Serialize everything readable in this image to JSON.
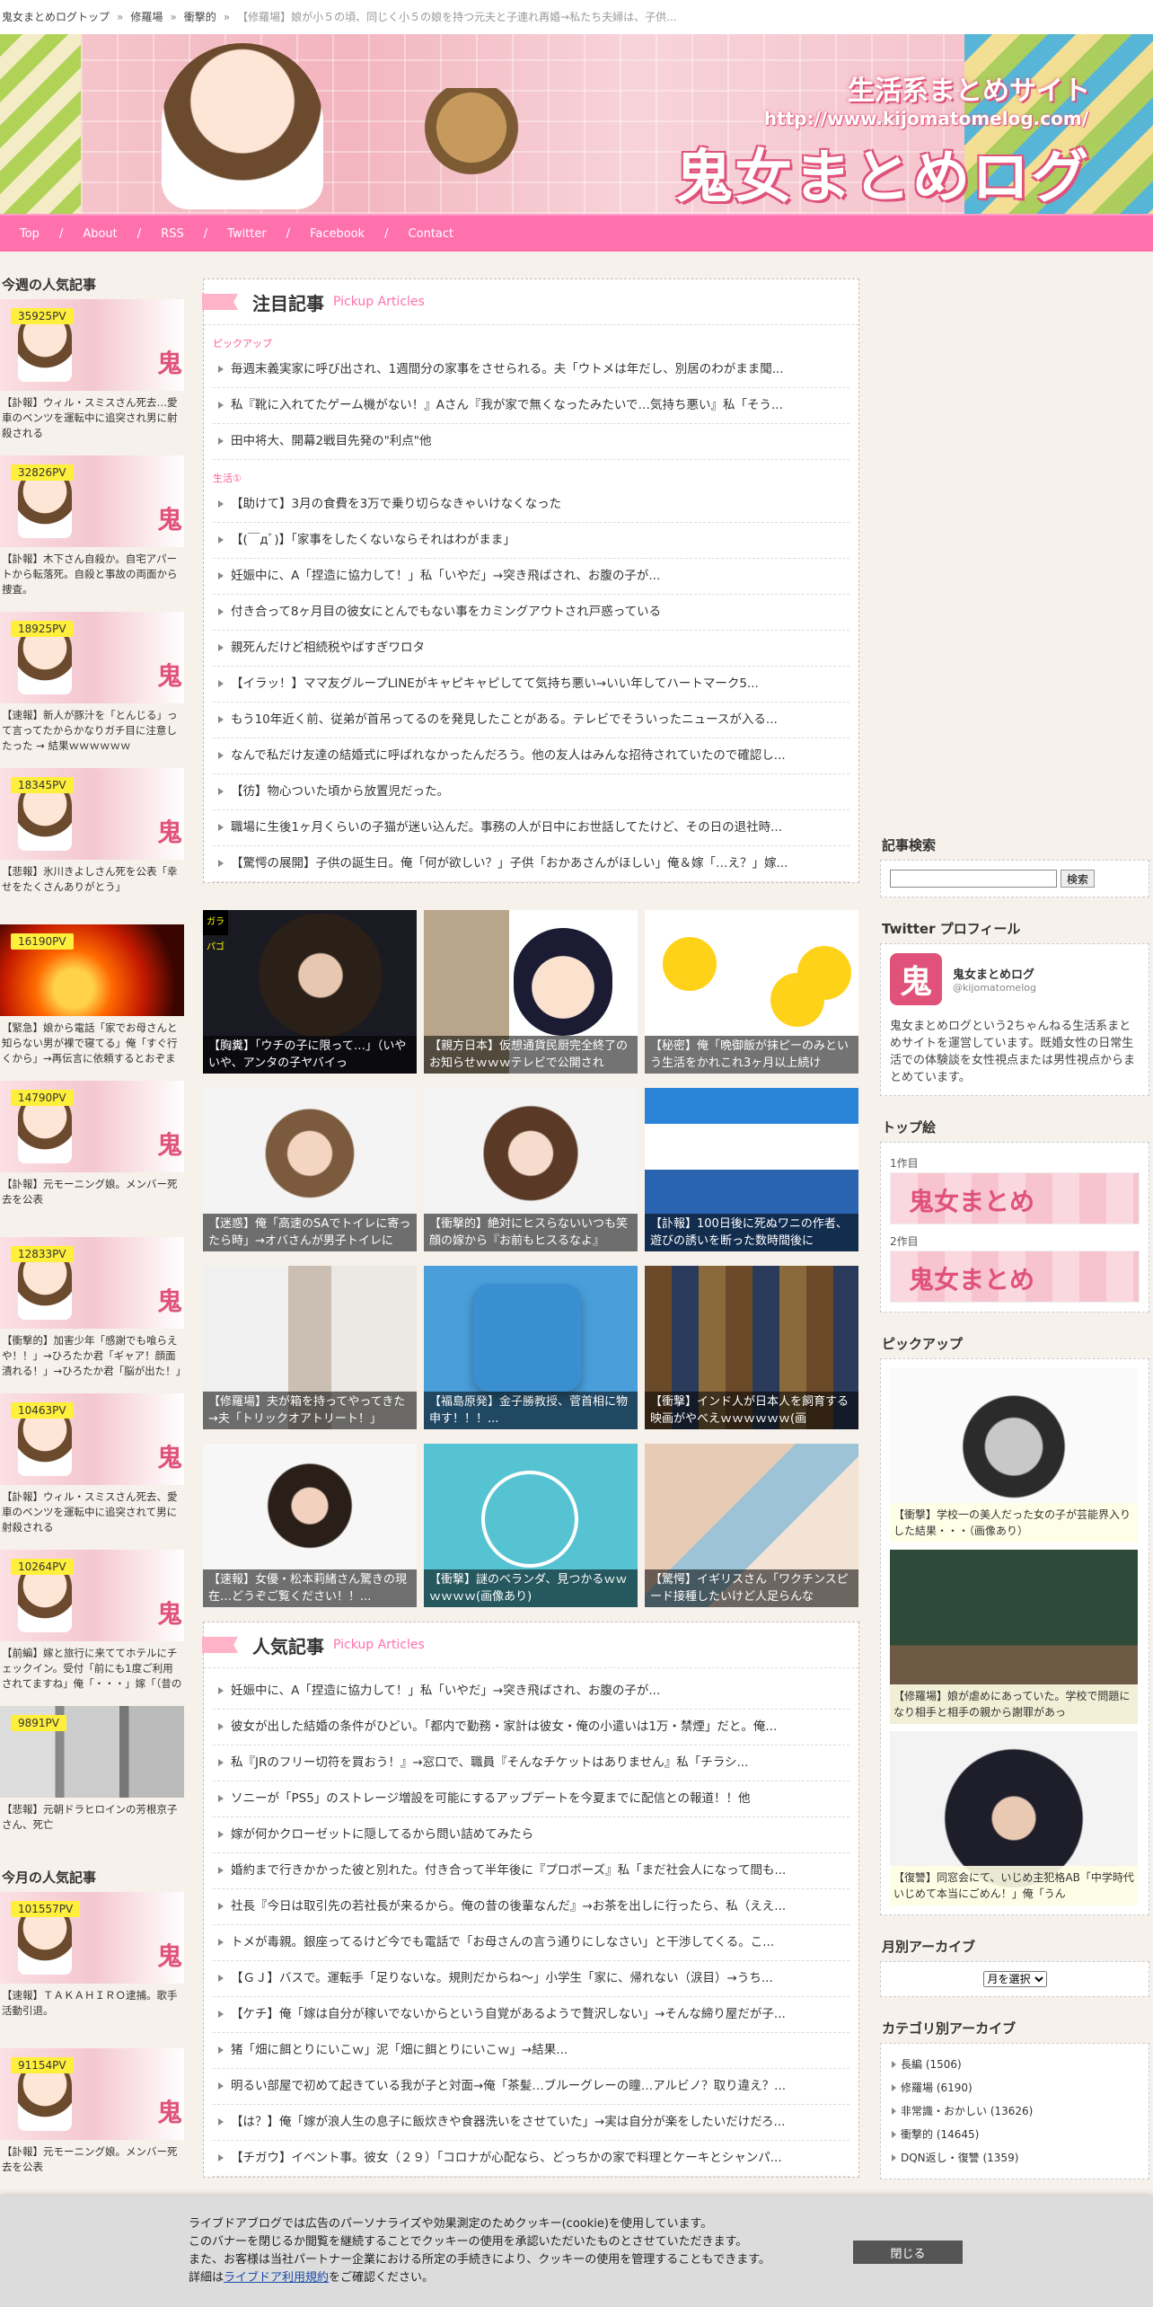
{
  "breadcrumb": {
    "items": [
      "鬼女まとめログトップ",
      "修羅場",
      "衝撃的"
    ],
    "current": "【修羅場】娘が小５の頃、同じく小５の娘を持つ元夫と子連れ再婚→私たち夫婦は、子供..."
  },
  "header": {
    "subtitle": "生活系まとめサイト",
    "url": "http://www.kijomatomelog.com/",
    "title": "鬼女まとめログ"
  },
  "nav": {
    "items": [
      "Top",
      "About",
      "RSS",
      "Twitter",
      "Facebook",
      "Contact"
    ]
  },
  "weekly_ranking": {
    "title": "今週の人気記事",
    "items": [
      {
        "pv": "35925PV",
        "caption": "【訃報】ウィル・スミスさん死去…愛車のベンツを運転中に追突され男に射殺される"
      },
      {
        "pv": "32826PV",
        "caption": "【訃報】木下さん自殺か。自宅アパートから転落死。自殺と事故の両面から捜査。"
      },
      {
        "pv": "18925PV",
        "caption": "【速報】新人が豚汁を「とんじる」って言ってたからかなりガチ目に注意したった → 結果ｗｗｗｗｗｗ"
      },
      {
        "pv": "18345PV",
        "caption": "【悲報】氷川きよしさん死を公表「幸せをたくさんありがとう」"
      },
      {
        "pv": "16190PV",
        "caption": "【緊急】娘から電話「家でお母さんと知らない男が裸で寝てる」俺「すぐ行くから」→再伝言に依頼するとおぞましい事実が明らかに・・・"
      },
      {
        "pv": "14790PV",
        "caption": "【訃報】元モーニング娘。メンバー死去を公表"
      },
      {
        "pv": "12833PV",
        "caption": "【衝撃的】加害少年「感謝でも喰らえや！！」→ひろたか君「ギャア！顔面潰れる！」→ひろたか君「脳が出た！」→脳に硫酸がかる→→"
      },
      {
        "pv": "10463PV",
        "caption": "【訃報】ウィル・スミスさん死去、愛車のベンツを運転中に追突されて男に射殺される"
      },
      {
        "pv": "10264PV",
        "caption": "【前編】嫁と旅行に来ててホテルにチェックイン。受付「前にも1度ご利用されてますね」俺「・・・」嫁「（昔の女と来てたの？）」→嫁が"
      },
      {
        "pv": "9891PV",
        "caption": "【悲報】元朝ドラヒロインの芳根京子さん、死亡"
      }
    ]
  },
  "monthly_ranking": {
    "title": "今月の人気記事",
    "items": [
      {
        "pv": "101557PV",
        "caption": "【速報】ＴＡＫＡＨＩＲＯ逮捕。歌手活動引退。"
      },
      {
        "pv": "91154PV",
        "caption": "【訃報】元モーニング娘。メンバー死去を公表"
      }
    ]
  },
  "pickup": {
    "title": "注目記事",
    "subtitle": "Pickup Articles",
    "group1_label": "ピックアップ",
    "group1": [
      "毎週末義実家に呼び出され、1週間分の家事をさせられる。夫「ウトメは年だし、別居のわがまま聞...",
      "私『靴に入れてたゲーム機がない！』Aさん『我が家で無くなったみたいで…気持ち悪い』私「そう...",
      "田中将大、開幕2戦目先発の\"利点\"他"
    ],
    "group2_label": "生活①",
    "group2": [
      "【助けて】3月の食費を3万で乗り切らなきゃいけなくなった",
      "【(￣дﾞ)】「家事をしたくないならそれはわがまま」",
      "妊娠中に、A「捏造に協力して！」私「いやだ」→突き飛ばされ、お腹の子が...",
      "付き合って8ヶ月目の彼女にとんでもない事をカミングアウトされ戸惑っている",
      "親死んだけど相続税やばすぎワロタ",
      "【イラッ！】ママ友グループLINEがキャピキャピしてて気持ち悪い→いい年してハートマーク5...",
      "もう10年近く前、従弟が首吊ってるのを発見したことがある。テレビでそういったニュースが入る...",
      "なんで私だけ友達の結婚式に呼ばれなかったんだろう。他の友人はみんな招待されていたので確認し...",
      "【彷】物心ついた頃から放置児だった。",
      "職場に生後1ヶ月くらいの子猫が迷い込んだ。事務の人が日中にお世話してたけど、その日の退社時...",
      "【驚愕の展開】子供の誕生日。俺「何が欲しい？」子供「おかあさんがほしい」俺＆嫁「…え？」嫁..."
    ]
  },
  "grid": [
    {
      "caption": "【胸糞】「ウチの子に限って…」（いやいや、アンタの子ヤバイっ",
      "badge": "ガラパゴ"
    },
    {
      "caption": "【親方日本】仮想通貨民厨完全終了のお知らせｗｗｗテレビで公開され"
    },
    {
      "caption": "【秘密】俺「晩御飯が抹ピーのみという生活をかれこれ3ヶ月以上続け"
    },
    {
      "caption": "【迷惑】俺「高速のSAでトイレに寄ったら時」→オバさんが男子トイレに"
    },
    {
      "caption": "【衝撃的】絶対にヒスらないいつも笑顔の嫁から『お前もヒスるなよ』"
    },
    {
      "caption": "【訃報】100日後に死ぬワニの作者、遊びの誘いを断った数時間後に"
    },
    {
      "caption": "【修羅場】夫が箱を持ってやってきた→夫「トリックオアトリート！」"
    },
    {
      "caption": "【福島原発】金子勝教授、菅首相に物申す！！！..."
    },
    {
      "caption": "【衝撃】インド人が日本人を飼育する映画がやべえｗｗｗｗｗｗ(画"
    },
    {
      "caption": "【速報】女優・松本莉緒さん驚きの現在…どうぞご覧ください！！..."
    },
    {
      "caption": "【衝撃】謎のベランダ、見つかるｗｗｗｗｗｗ(画像あり)"
    },
    {
      "caption": "【驚愕】イギリスさん「ワクチンスピード接種したいけど人足らんな"
    }
  ],
  "popular": {
    "title": "人気記事",
    "subtitle": "Pickup Articles",
    "items": [
      "妊娠中に、A「捏造に協力して！」私「いやだ」→突き飛ばされ、お腹の子が...",
      "彼女が出した結婚の条件がひどい。「都内で勤務・家計は彼女・俺の小遣いは1万・禁煙」だと。俺...",
      "私『JRのフリー切符を買おう！』→窓口で、職員『そんなチケットはありません』私「チラシ...",
      "ソニーが「PS5」のストレージ増設を可能にするアップデートを今夏までに配信との報道！！他",
      "嫁が何かクローゼットに隠してるから問い詰めてみたら",
      "婚約まで行きかかった彼と別れた。付き合って半年後に『プロポーズ』私「まだ社会人になって間も...",
      "社長『今日は取引先の若社長が来るから。俺の昔の後輩なんだ』→お茶を出しに行ったら、私（ええ...",
      "トメが毒親。銀座ってるけど今でも電話で「お母さんの言う通りにしなさい」と干渉してくる。こ...",
      "【ＧＪ】バスで。運転手「足りないな。規則だからね～」小学生「家に、帰れない（涙目）→うち...",
      "【ケチ】俺「嫁は自分が稼いでないからという自覚があるようで贅沢しない」→そんな締り屋だが子...",
      "猪「畑に餌とりにいこｗ」泥「畑に餌とりにいこｗ」→結果...",
      "明るい部屋で初めて起きている我が子と対面→俺「茶髪…ブルーグレーの瞳…アルビノ？取り違え？...",
      "【は？】俺「嫁が浪人生の息子に飯炊きや食器洗いをさせていた」→実は自分が楽をしたいだけだろ...",
      "【チガウ】イベント事。彼女（２９）「コロナが心配なら、どっちかの家で料理とケーキとシャンパ..."
    ]
  },
  "search": {
    "title": "記事検索",
    "button": "検索",
    "placeholder": ""
  },
  "twitter": {
    "title": "Twitter プロフィール",
    "avatar": "鬼",
    "name": "鬼女まとめログ",
    "handle": "@kijomatomelog",
    "desc": "鬼女まとめログという2ちゃんねる生活系まとめサイトを運営しています。既婚女性の日常生活での体験談を女性視点または男性視点からまとめています。"
  },
  "top_pics": {
    "title": "トップ絵",
    "items": [
      {
        "label": "1作目",
        "text": "鬼女まとめ"
      },
      {
        "label": "2作目",
        "text": "鬼女まとめ"
      }
    ]
  },
  "pickup_side": {
    "title": "ピックアップ",
    "items": [
      "【衝撃】学校一の美人だった女の子が芸能界入りした結果・・・（画像あり）",
      "【修羅場】娘が虐めにあっていた。学校で問題になり相手と相手の親から謝罪があっ",
      "【復讐】同窓会にて、いじめ主犯格AB「中学時代いじめて本当にごめん！」俺「うん"
    ]
  },
  "archive": {
    "title": "月別アーカイブ",
    "select": "月を選択"
  },
  "categories": {
    "title": "カテゴリ別アーカイブ",
    "items": [
      "長編 (1506)",
      "修羅場 (6190)",
      "非常識・おかしい (13626)",
      "衝撃的 (14645)",
      "DQN返し・復讐 (1359)"
    ]
  },
  "cookie": {
    "line1": "ライブドアブログでは広告のパーソナライズや効果測定のためクッキー(cookie)を使用しています。",
    "line2": "このバナーを閉じるか閲覧を継続することでクッキーの使用を承認いただいたものとさせていただきます。",
    "line3": "また、お客様は当社パートナー企業における所定の手続きにより、クッキーの使用を管理することもできます。",
    "line4_pre": "詳細は",
    "line4_link": "ライブドア利用規約",
    "line4_post": "をご確認ください。",
    "close": "閉じる"
  }
}
